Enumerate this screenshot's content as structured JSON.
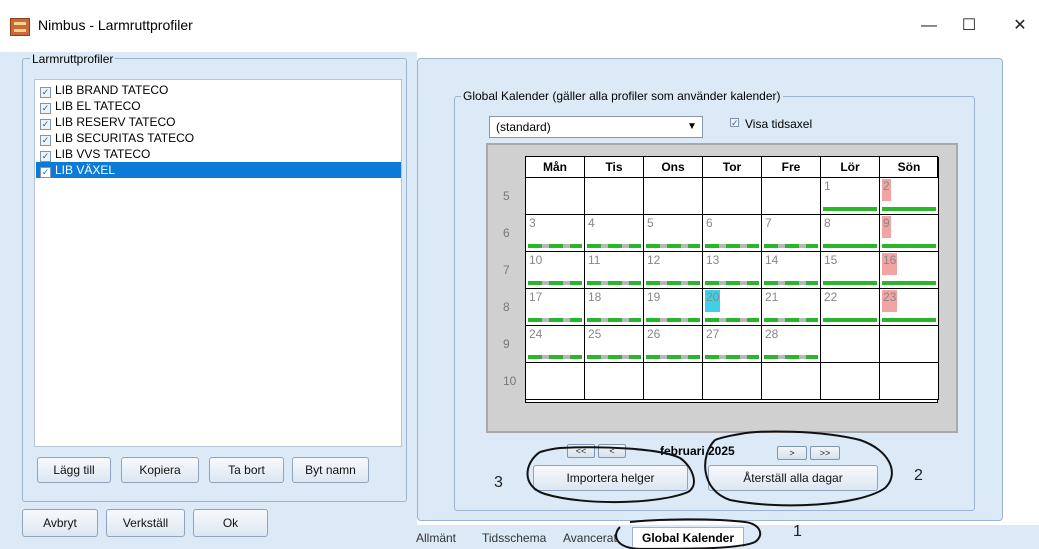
{
  "window": {
    "title": "Nimbus - Larmruttprofiler",
    "minimize_icon": "minimize-icon",
    "maximize_icon": "maximize-icon",
    "close_icon": "close-icon"
  },
  "profiles": {
    "group_label": "Larmruttprofiler",
    "items": [
      {
        "label": "LIB BRAND TATECO",
        "checked": true
      },
      {
        "label": "LIB EL TATECO",
        "checked": true
      },
      {
        "label": "LIB RESERV TATECO",
        "checked": true
      },
      {
        "label": "LIB SECURITAS TATECO",
        "checked": true
      },
      {
        "label": "LIB VVS TATECO",
        "checked": true
      },
      {
        "label": "LIB VÄXEL",
        "checked": true,
        "selected": true
      }
    ],
    "buttons": {
      "add": "Lägg till",
      "copy": "Kopiera",
      "delete": "Ta bort",
      "rename": "Byt namn"
    }
  },
  "footer_buttons": {
    "cancel": "Avbryt",
    "apply": "Verkställ",
    "ok": "Ok"
  },
  "global_calendar": {
    "group_label": "Global Kalender (gäller alla profiler som använder kalender)",
    "calendar_select": "(standard)",
    "show_timeaxis_label": "Visa tidsaxel",
    "show_timeaxis_checked": true,
    "day_headers": [
      "Mån",
      "Tis",
      "Ons",
      "Tor",
      "Fre",
      "Lör",
      "Sön"
    ],
    "week_numbers": [
      "5",
      "6",
      "7",
      "8",
      "9",
      "10"
    ],
    "weeks": [
      [
        "",
        "",
        "",
        "",
        "",
        "1",
        "2"
      ],
      [
        "3",
        "4",
        "5",
        "6",
        "7",
        "8",
        "9"
      ],
      [
        "10",
        "11",
        "12",
        "13",
        "14",
        "15",
        "16"
      ],
      [
        "17",
        "18",
        "19",
        "20",
        "21",
        "22",
        "23"
      ],
      [
        "24",
        "25",
        "26",
        "27",
        "28",
        "",
        ""
      ],
      [
        "",
        "",
        "",
        "",
        "",
        "",
        ""
      ]
    ],
    "holidays": [
      "2",
      "9",
      "16",
      "23"
    ],
    "today": "20",
    "month_label": "februari 2025",
    "nav": {
      "first": "<<",
      "prev": "<",
      "next": ">",
      "last": ">>"
    },
    "import_holidays": "Importera helger",
    "reset_all_days": "Återställ alla dagar",
    "colors": {
      "holiday": "#f4a3a3",
      "today": "#3fd0e8",
      "schedule_bar": "#2ab52a",
      "selection": "#0c7ad6"
    }
  },
  "tabs": [
    {
      "label": "Allmänt"
    },
    {
      "label": "Tidsschema"
    },
    {
      "label": "Avancerat"
    },
    {
      "label": "Global Kalender",
      "active": true
    }
  ],
  "annotations": [
    "1",
    "2",
    "3"
  ]
}
